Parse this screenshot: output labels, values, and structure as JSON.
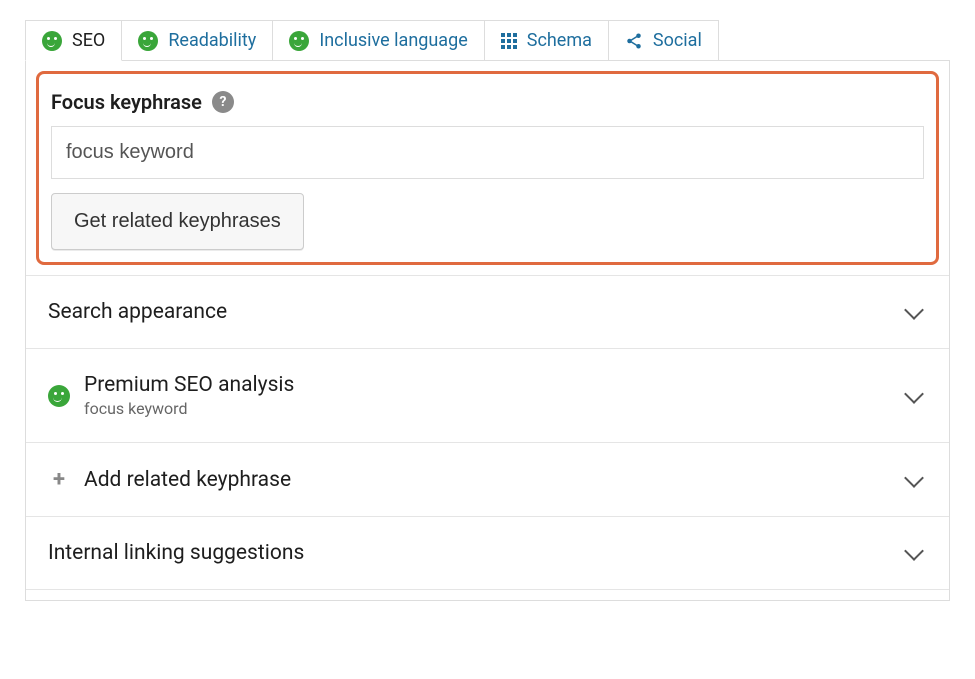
{
  "tabs": [
    {
      "label": "SEO"
    },
    {
      "label": "Readability"
    },
    {
      "label": "Inclusive language"
    },
    {
      "label": "Schema"
    },
    {
      "label": "Social"
    }
  ],
  "focus": {
    "label": "Focus keyphrase",
    "help_symbol": "?",
    "input_value": "focus keyword",
    "related_button": "Get related keyphrases"
  },
  "accordion": [
    {
      "title": "Search appearance"
    },
    {
      "title": "Premium SEO analysis",
      "subtitle": "focus keyword"
    },
    {
      "title": "Add related keyphrase"
    },
    {
      "title": "Internal linking suggestions"
    }
  ],
  "icons": {
    "plus": "+"
  }
}
